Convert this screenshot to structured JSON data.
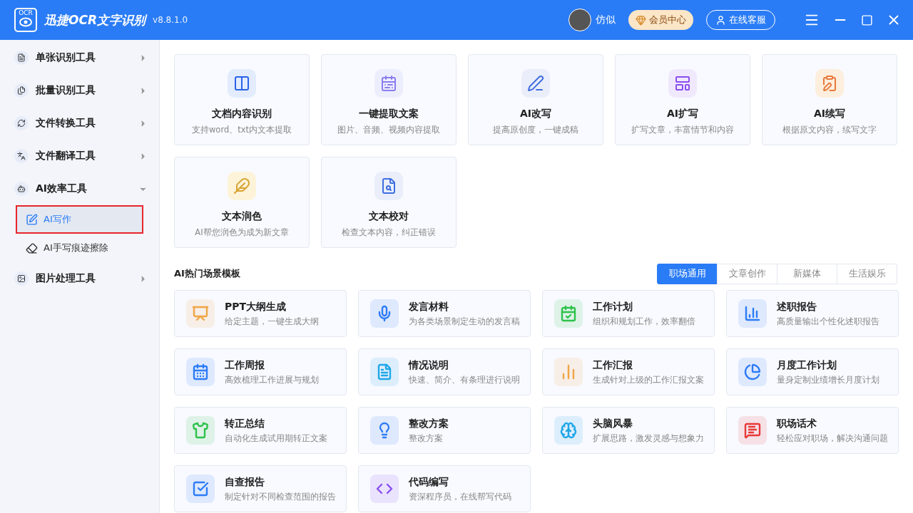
{
  "header": {
    "logo_badge": "OCR",
    "app_name": "迅捷OCR文字识别",
    "version": "v8.8.1.0",
    "user_name": "仿似",
    "vip_button": "会员中心",
    "service_button": "在线客服"
  },
  "sidebar": {
    "items": [
      {
        "label": "单张识别工具",
        "expanded": false
      },
      {
        "label": "批量识别工具",
        "expanded": false
      },
      {
        "label": "文件转换工具",
        "expanded": false
      },
      {
        "label": "文件翻译工具",
        "expanded": false
      },
      {
        "label": "AI效率工具",
        "expanded": true,
        "children": [
          {
            "label": "AI写作",
            "selected": true
          },
          {
            "label": "AI手写痕迹擦除",
            "selected": false
          }
        ]
      },
      {
        "label": "图片处理工具",
        "expanded": false
      }
    ]
  },
  "tools": [
    {
      "title": "文档内容识别",
      "subtitle": "支持word、txt内文本提取"
    },
    {
      "title": "一键提取文案",
      "subtitle": "图片、音频、视频内容提取"
    },
    {
      "title": "AI改写",
      "subtitle": "提高原创度，一键成稿"
    },
    {
      "title": "AI扩写",
      "subtitle": "扩写文章，丰富情节和内容"
    },
    {
      "title": "AI续写",
      "subtitle": "根据原文内容，续写文字"
    },
    {
      "title": "文本润色",
      "subtitle": "AI帮您润色为成为新文章"
    },
    {
      "title": "文本校对",
      "subtitle": "检查文本内容，纠正错误"
    }
  ],
  "templates_section": {
    "title": "AI热门场景模板",
    "tabs": [
      {
        "label": "职场通用",
        "selected": true
      },
      {
        "label": "文章创作",
        "selected": false
      },
      {
        "label": "新媒体",
        "selected": false
      },
      {
        "label": "生活娱乐",
        "selected": false
      }
    ],
    "templates": [
      {
        "title": "PPT大纲生成",
        "subtitle": "给定主题，一键生成大纲",
        "color": "#f0a545"
      },
      {
        "title": "发言材料",
        "subtitle": "为各类场景制定生动的发言稿",
        "color": "#2e7cf6"
      },
      {
        "title": "工作计划",
        "subtitle": "组织和规划工作，效率翻倍",
        "color": "#2ec24a"
      },
      {
        "title": "述职报告",
        "subtitle": "高质量输出个性化述职报告",
        "color": "#2e7cf6"
      },
      {
        "title": "工作周报",
        "subtitle": "高效梳理工作进展与规划",
        "color": "#2e7cf6"
      },
      {
        "title": "情况说明",
        "subtitle": "快速、简介、有条理进行说明",
        "color": "#1fa6e8"
      },
      {
        "title": "工作汇报",
        "subtitle": "生成针对上级的工作汇报文案",
        "color": "#f0a545"
      },
      {
        "title": "月度工作计划",
        "subtitle": "量身定制业绩增长月度计划",
        "color": "#2e7cf6"
      },
      {
        "title": "转正总结",
        "subtitle": "自动化生成试用期转正文案",
        "color": "#2ec24a"
      },
      {
        "title": "整改方案",
        "subtitle": "整改方案",
        "color": "#2e7cf6"
      },
      {
        "title": "头脑风暴",
        "subtitle": "扩展思路，激发灵感与想象力",
        "color": "#1fa6e8"
      },
      {
        "title": "职场话术",
        "subtitle": "轻松应对职场，解决沟通问题",
        "color": "#e83a3a"
      },
      {
        "title": "自查报告",
        "subtitle": "制定针对不同检查范围的报告",
        "color": "#2e7cf6"
      },
      {
        "title": "代码编写",
        "subtitle": "资深程序员，在线帮写代码",
        "color": "#8a4ef0"
      }
    ]
  }
}
